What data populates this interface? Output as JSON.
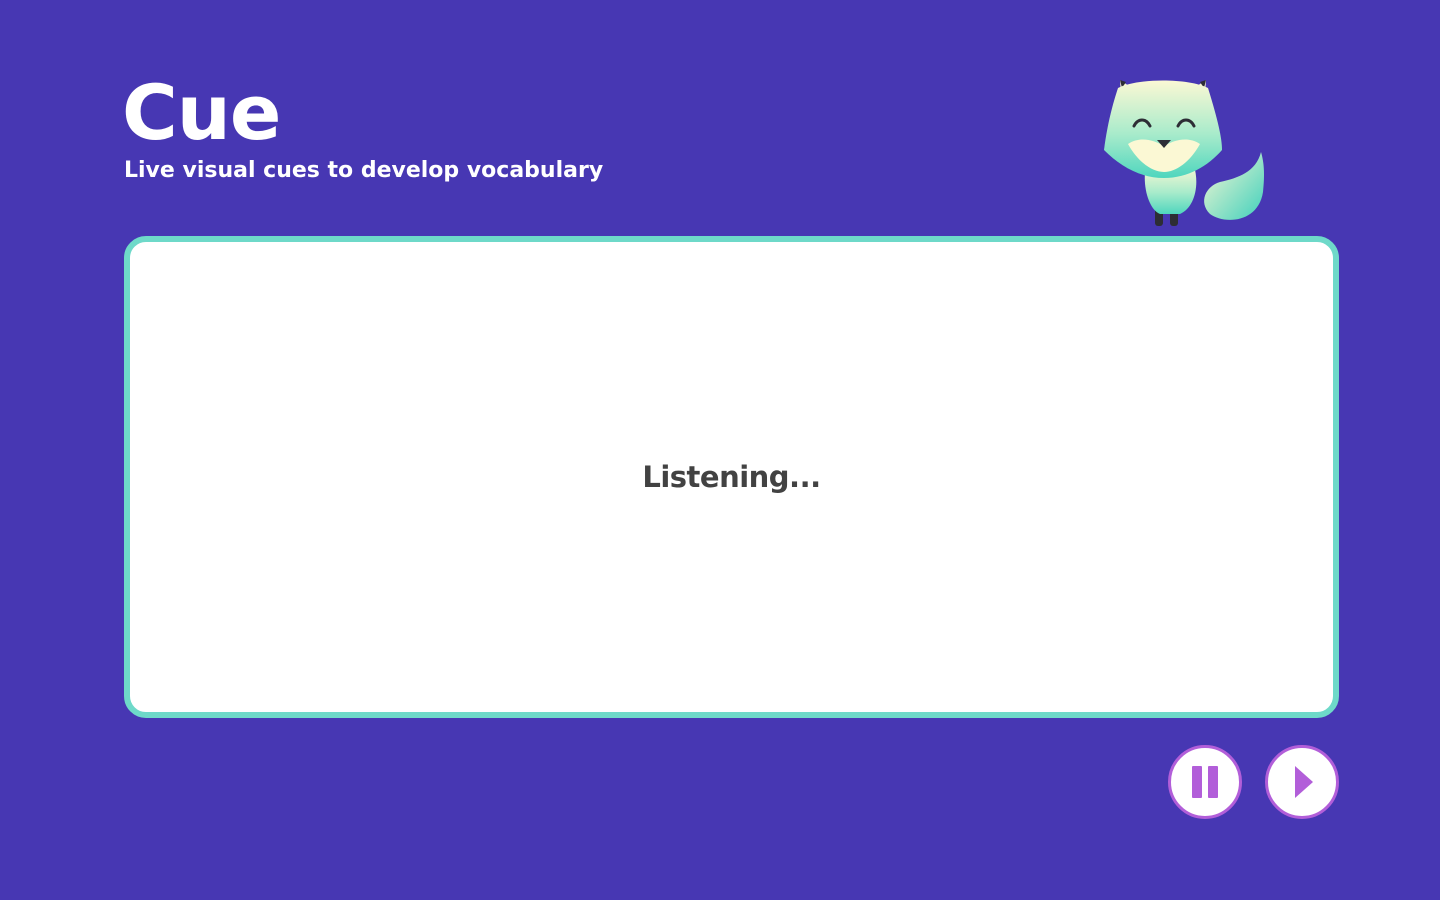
{
  "app": {
    "title": "Cue",
    "subtitle": "Live visual cues to develop vocabulary"
  },
  "mascot": {
    "icon": "fox-mascot-icon"
  },
  "cue_panel": {
    "status_text": "Listening..."
  },
  "controls": {
    "pause": {
      "icon": "pause-icon",
      "aria_label": "Pause"
    },
    "next": {
      "icon": "play-icon",
      "aria_label": "Play"
    }
  },
  "colors": {
    "background": "#4737B3",
    "panel_border": "#6ED9C9",
    "button_accent": "#B25ED9",
    "status_text": "#424242"
  }
}
